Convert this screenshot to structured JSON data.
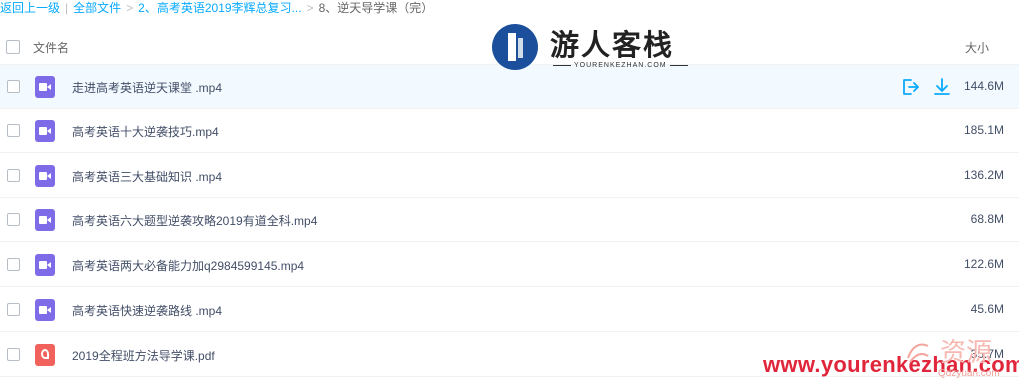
{
  "breadcrumb": {
    "back": "返回上一级",
    "sep": "|",
    "all_files": "全部文件",
    "arrow": ">",
    "parent": "2、高考英语2019李辉总复习...",
    "current": "8、逆天导学课（完）"
  },
  "header": {
    "name_col": "文件名",
    "size_col": "大小"
  },
  "files": [
    {
      "name": "走进高考英语逆天课堂 .mp4",
      "size": "144.6M",
      "type": "video-icon"
    },
    {
      "name": "高考英语十大逆袭技巧.mp4",
      "size": "185.1M",
      "type": "video-icon"
    },
    {
      "name": "高考英语三大基础知识 .mp4",
      "size": "136.2M",
      "type": "video-icon"
    },
    {
      "name": "高考英语六大题型逆袭攻略2019有道全科.mp4",
      "size": "68.8M",
      "type": "video-icon"
    },
    {
      "name": "高考英语两大必备能力加q2984599145.mp4",
      "size": "122.6M",
      "type": "video-icon"
    },
    {
      "name": "高考英语快速逆袭路线 .mp4",
      "size": "45.6M",
      "type": "video-icon"
    },
    {
      "name": "2019全程班方法导学课.pdf",
      "size": "35.7M",
      "type": "pdf-icon"
    }
  ],
  "row_actions": {
    "share": "share-icon",
    "download": "download-icon"
  },
  "logo": {
    "title": "游人客栈",
    "subtitle": "YOURENKEZHAN.COM"
  },
  "watermark": {
    "url": "www.yourenkezhan.com",
    "cn": "资源",
    "small": "Qdzyuan.com"
  },
  "colors": {
    "accent": "#09aaff",
    "video": "#7e6be8",
    "pdf": "#f0625b",
    "hover_row": "#f2f9ff",
    "watermark": "#e0263a"
  }
}
